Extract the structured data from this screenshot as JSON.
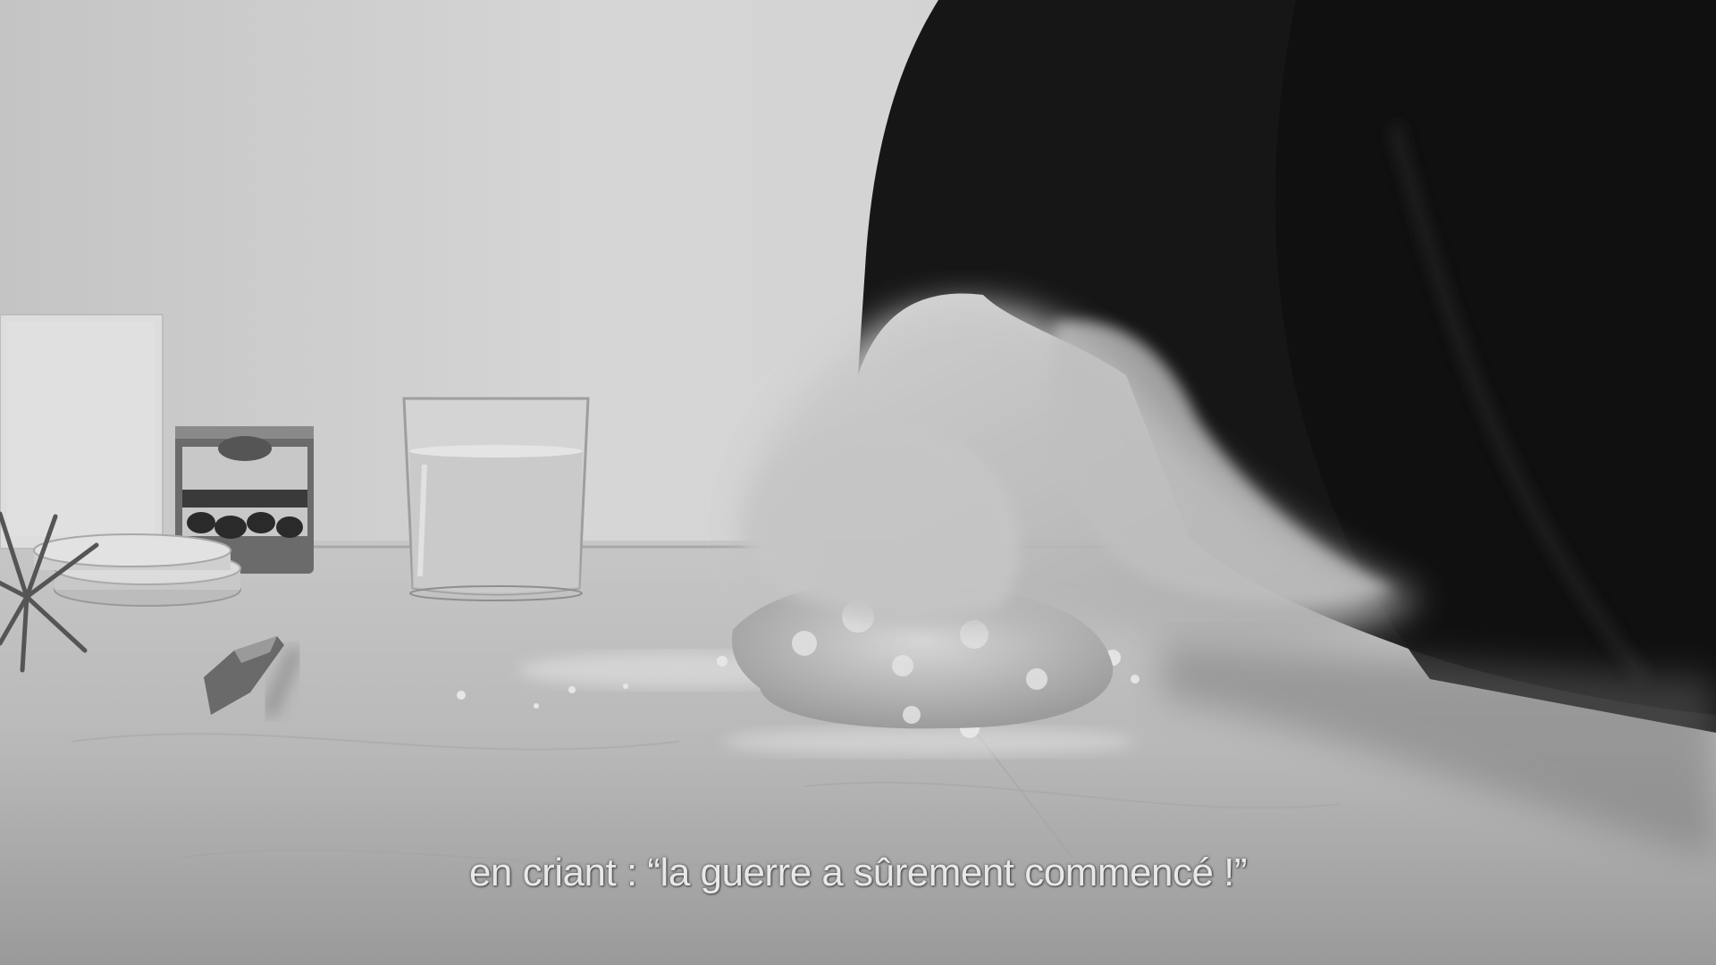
{
  "video": {
    "subtitle": "en criant : “la guerre a sûrement commencé !”"
  },
  "colors": {
    "wall": "#cfcfcf",
    "counter": "#bcbcbc",
    "sleeve": "#151515",
    "subtitle": "#e8e8e8"
  }
}
